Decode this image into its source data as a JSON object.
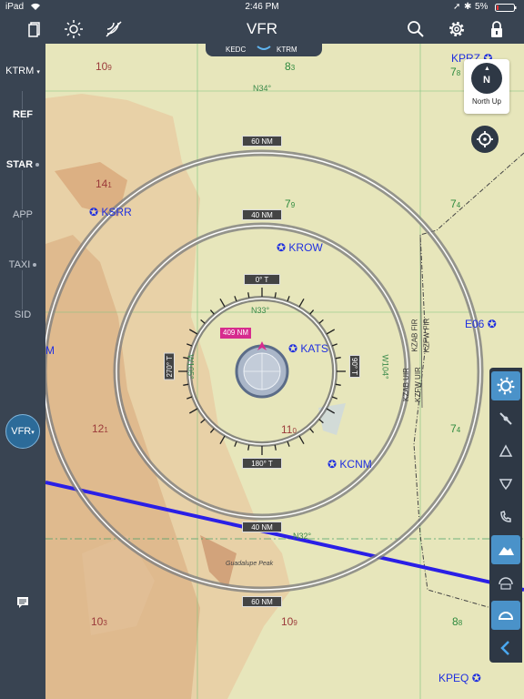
{
  "status": {
    "device": "iPad",
    "time": "2:46 PM",
    "battery": "5%"
  },
  "nav": {
    "title": "VFR",
    "left_icons": [
      "documents-icon",
      "brightness-icon",
      "radar-icon"
    ],
    "right_icons": [
      "search-icon",
      "settings-icon",
      "lock-icon"
    ]
  },
  "route": {
    "from": "KEDC",
    "to": "KTRM"
  },
  "sidebar": {
    "airport": "KTRM",
    "items": [
      {
        "label": "REF",
        "bold": true,
        "dot": false
      },
      {
        "label": "STAR",
        "bold": true,
        "dot": true
      },
      {
        "label": "APP",
        "bold": false,
        "dot": false
      },
      {
        "label": "TAXI",
        "bold": false,
        "dot": true
      },
      {
        "label": "SID",
        "bold": false,
        "dot": false
      }
    ],
    "vfr_badge": "VFR"
  },
  "north_up": {
    "letter": "N",
    "label": "North Up"
  },
  "airports": [
    {
      "id": "KPRZ"
    },
    {
      "id": "KSRR"
    },
    {
      "id": "KROW"
    },
    {
      "id": "KATS"
    },
    {
      "id": "E06"
    },
    {
      "id": "KCNM"
    },
    {
      "id": "KPEQ"
    }
  ],
  "grid_numbers": [
    {
      "big": "10",
      "small": "9"
    },
    {
      "big": "8",
      "small": "3"
    },
    {
      "big": "7",
      "small": "8"
    },
    {
      "big": "14",
      "small": "1"
    },
    {
      "big": "7",
      "small": "9"
    },
    {
      "big": "7",
      "small": "4"
    },
    {
      "big": "12",
      "small": "1"
    },
    {
      "big": "11",
      "small": "0"
    },
    {
      "big": "7",
      "small": "4"
    },
    {
      "big": "10",
      "small": "3"
    },
    {
      "big": "10",
      "small": "9"
    },
    {
      "big": "8",
      "small": "8"
    }
  ],
  "map_text": {
    "lat34": "N34°",
    "lat33": "N33°",
    "lat32": "N32°",
    "lon104": "W104°",
    "lon105": "W105°",
    "fir1": "KZAB FIR",
    "fir2": "KZFW FIR",
    "uir1": "KZAB UIR",
    "uir2": "KZFW UIR",
    "peak": "Guadalupe Peak",
    "partial_label": "M"
  },
  "rings": {
    "outer": "60 NM",
    "middle": "40 NM",
    "bottom_middle": "40 NM",
    "bottom_outer": "60 NM",
    "top": "0° T",
    "bottom": "180° T",
    "left": "270° T",
    "right": "90° T",
    "distance": "409 NM"
  },
  "colors": {
    "bar": "#394452",
    "route": "#2a1fe6",
    "airport": "#1f2fe0",
    "active_layer": "#4a92c9",
    "distance_tag": "#d62c8e"
  }
}
